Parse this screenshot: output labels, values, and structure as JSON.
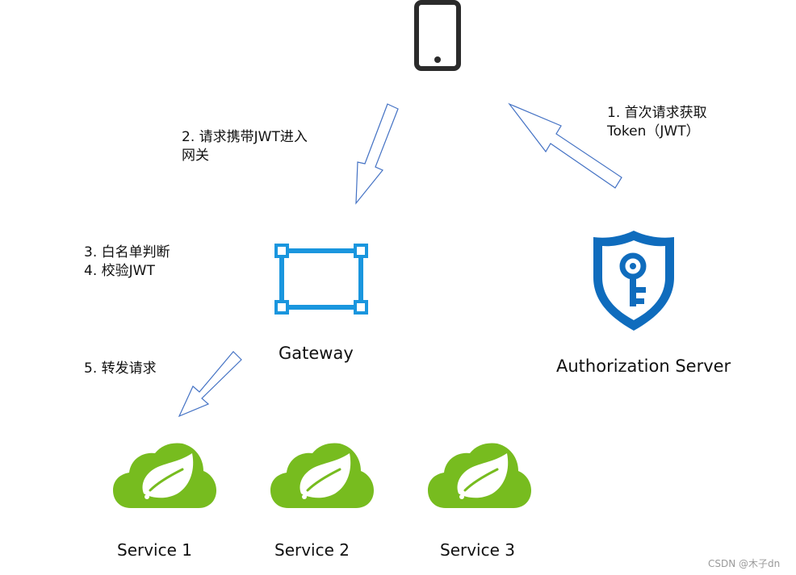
{
  "colors": {
    "arrow_stroke": "#4472c4",
    "gateway_blue": "#1a96de",
    "shield_blue": "#0f6cbd",
    "spring_green": "#77bc1f",
    "phone_dark": "#2b2b2b",
    "watermark": "#9a9a9a"
  },
  "icons": {
    "client": "smartphone-icon",
    "gateway": "gateway-frame-icon",
    "auth": "shield-key-icon",
    "service": "spring-cloud-icon"
  },
  "nodes": {
    "gateway_label": "Gateway",
    "auth_label": "Authorization Server",
    "services": [
      "Service 1",
      "Service 2",
      "Service 3"
    ]
  },
  "notes": {
    "step1_line1": "1. 首次请求获取",
    "step1_line2": "Token（JWT）",
    "step2_line1": "2. 请求携带JWT进入",
    "step2_line2": "网关",
    "step3": "3. 白名单判断",
    "step4": "4. 校验JWT",
    "step5": "5. 转发请求"
  },
  "watermark": "CSDN @木子dn"
}
